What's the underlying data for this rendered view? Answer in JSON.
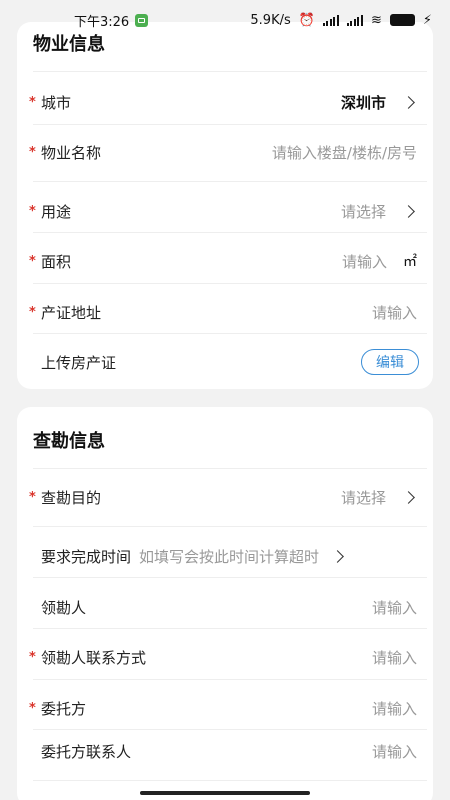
{
  "status_bar": {
    "time": "下午3:26",
    "network_speed": "5.9K/s",
    "battery": "62"
  },
  "section_property": {
    "title": "物业信息",
    "city": {
      "label": "城市",
      "value": "深圳市"
    },
    "property_name": {
      "label": "物业名称",
      "placeholder": "请输入楼盘/楼栋/房号"
    },
    "usage": {
      "label": "用途",
      "placeholder": "请选择"
    },
    "area": {
      "label": "面积",
      "placeholder": "请输入",
      "unit": "㎡"
    },
    "certificate_address": {
      "label": "产证地址",
      "placeholder": "请输入"
    },
    "upload_certificate": {
      "label": "上传房产证",
      "button": "编辑"
    }
  },
  "section_survey": {
    "title": "查勘信息",
    "purpose": {
      "label": "查勘目的",
      "placeholder": "请选择"
    },
    "deadline": {
      "label": "要求完成时间",
      "placeholder": "如填写会按此时间计算超时"
    },
    "lead_surveyor": {
      "label": "领勘人",
      "placeholder": "请输入"
    },
    "lead_contact": {
      "label": "领勘人联系方式",
      "placeholder": "请输入"
    },
    "client": {
      "label": "委托方",
      "placeholder": "请输入"
    },
    "client_contact": {
      "label": "委托方联系人",
      "placeholder": "请输入"
    }
  },
  "required_mark": "*",
  "icons": {
    "chevron": "chevron-right-icon"
  }
}
